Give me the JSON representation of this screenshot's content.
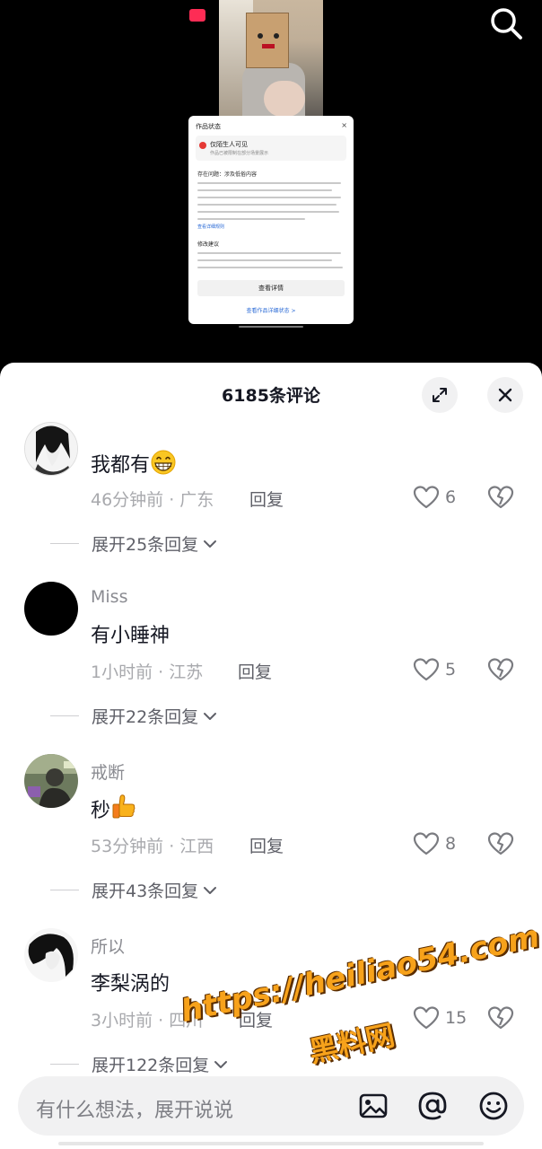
{
  "video": {
    "status_card": {
      "title": "作品状态",
      "close": "×",
      "warning_title": "仅陌生人可见",
      "warning_desc": "作品已被限制在部分场景展示",
      "issue_heading": "存在问题：涉及低俗内容",
      "issue_link": "查看详细规则",
      "suggest_heading": "修改建议",
      "detail_button": "查看详情",
      "footer_link": "查看作品详细状态 >"
    }
  },
  "header": {
    "title": "6185条评论"
  },
  "comments": [
    {
      "username": "",
      "text": "我都有",
      "emoji": "grin-icon",
      "time": "46分钟前 · 广东",
      "reply": "回复",
      "likes": "6",
      "expand": "展开25条回复"
    },
    {
      "username": "Miss",
      "text": "有小睡神",
      "time": "1小时前 · 江苏",
      "reply": "回复",
      "likes": "5",
      "expand": "展开22条回复"
    },
    {
      "username": "戒断",
      "text": "秒",
      "emoji": "thumbs-up-icon",
      "time": "53分钟前 · 江西",
      "reply": "回复",
      "likes": "8",
      "expand": "展开43条回复"
    },
    {
      "username": "所以",
      "text": "李梨涡的",
      "time": "3小时前 · 四川",
      "reply": "回复",
      "likes": "15",
      "expand": "展开122条回复"
    }
  ],
  "watermark": {
    "url": "https://heiliao54.com",
    "name": "黑料网"
  },
  "input": {
    "placeholder": "有什么想法，展开说说"
  },
  "colors": {
    "sheet_bg": "#ffffff",
    "text_primary": "#161823",
    "text_secondary": "#a8a9ad",
    "watermark": "#f7a21b"
  }
}
